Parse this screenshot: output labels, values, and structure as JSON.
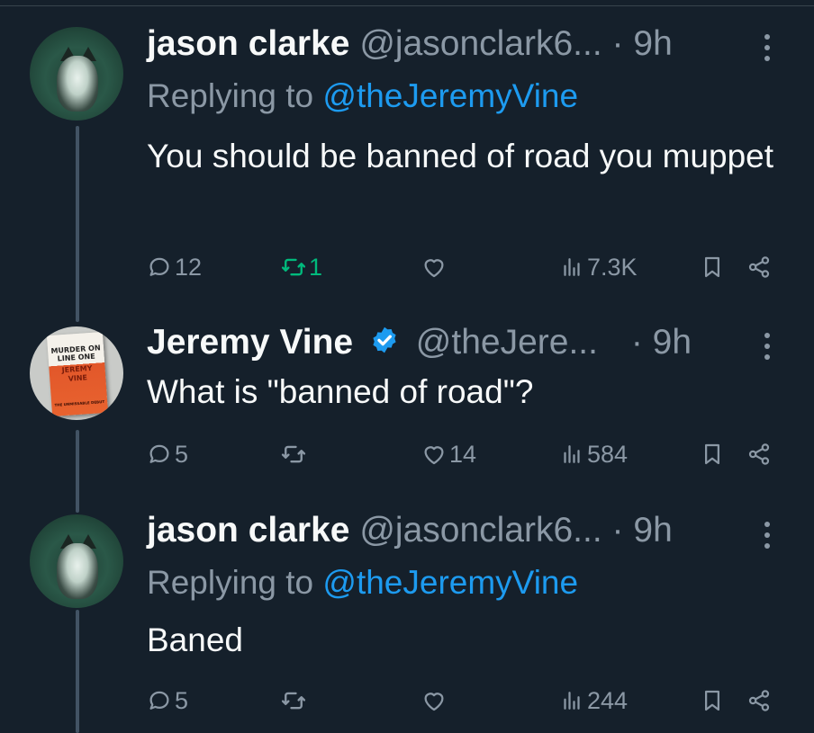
{
  "tweets": [
    {
      "name": "jason clarke",
      "handle": "@jasonclark6...",
      "dot": "·",
      "time": "9h",
      "replying_prefix": "Replying to",
      "replying_to": "@theJeremyVine",
      "text": "You should be banned of road you muppet",
      "avatar": "cat-photo",
      "verified": false,
      "replies": "12",
      "retweets": "1",
      "retweeted": true,
      "likes": "",
      "views": "7.3K"
    },
    {
      "name": "Jeremy Vine",
      "handle": "@theJere...",
      "dot": "·",
      "time": "9h",
      "text": "What is \"banned of road\"?",
      "avatar": "book-cover",
      "avatar_text": [
        "MURDER ON",
        "LINE ONE",
        "JEREMY",
        "VINE",
        "THE UNMISSABLE DEBUT"
      ],
      "verified": true,
      "replies": "5",
      "retweets": "",
      "likes": "14",
      "views": "584"
    },
    {
      "name": "jason clarke",
      "handle": "@jasonclark6...",
      "dot": "·",
      "time": "9h",
      "replying_prefix": "Replying to",
      "replying_to": "@theJeremyVine",
      "text": "Baned",
      "avatar": "cat-photo",
      "verified": false,
      "replies": "5",
      "retweets": "",
      "likes": "",
      "views": "244"
    }
  ],
  "icons": {
    "reply": "reply-icon",
    "retweet": "retweet-icon",
    "like": "heart-icon",
    "views": "views-icon",
    "bookmark": "bookmark-icon",
    "share": "share-icon",
    "more": "more-icon",
    "verified": "verified-badge-icon"
  },
  "colors": {
    "background": "#15202b",
    "text": "#f7f9f9",
    "muted": "#8b98a5",
    "link": "#1d9bf0",
    "retweeted": "#00ba7c",
    "thread_line": "#425364"
  }
}
